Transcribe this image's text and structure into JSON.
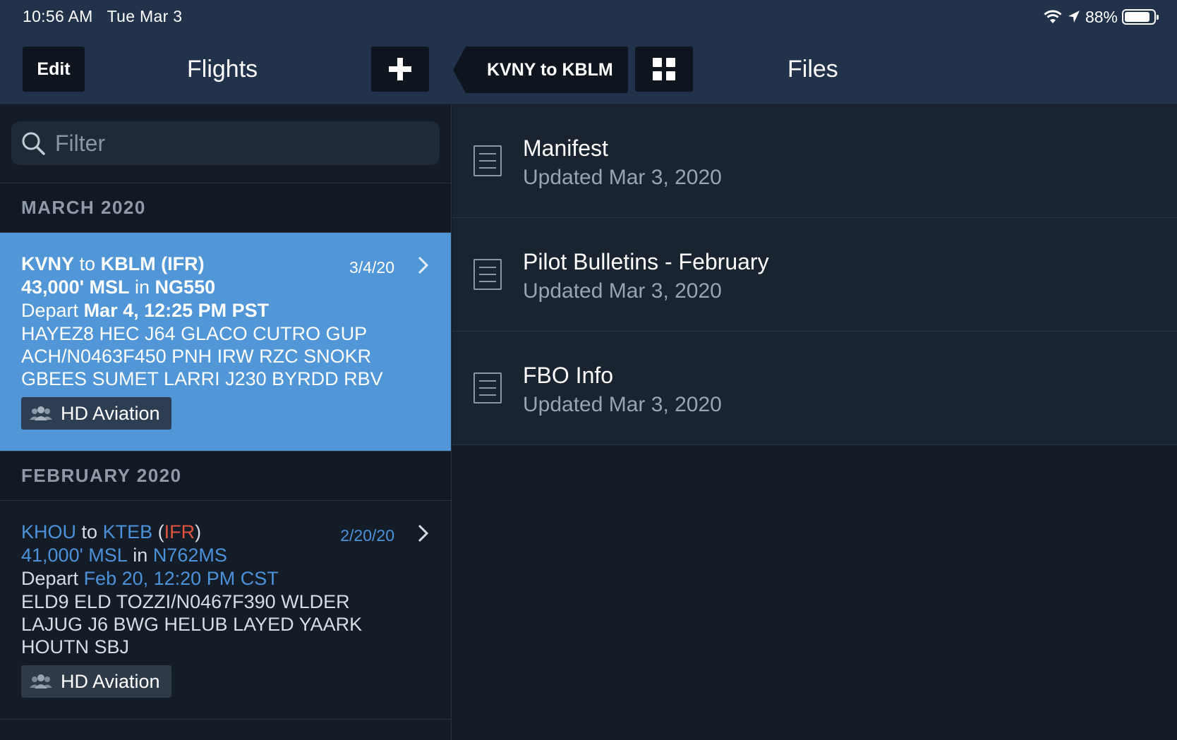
{
  "status": {
    "time": "10:56 AM",
    "date": "Tue Mar 3",
    "battery": "88%",
    "battery_level": 0.88
  },
  "nav": {
    "edit_label": "Edit",
    "flights_title": "Flights",
    "back_label": "KVNY to KBLM",
    "files_title": "Files"
  },
  "filter": {
    "placeholder": "Filter"
  },
  "sections": {
    "march": "MARCH 2020",
    "february": "FEBRUARY 2020"
  },
  "flights": [
    {
      "from": "KVNY",
      "to_word": "to",
      "to": "KBLM",
      "rules": "IFR",
      "date": "3/4/20",
      "altitude": "43,000' MSL",
      "in_word": "in",
      "aircraft": "NG550",
      "depart_word": "Depart",
      "depart_time": "Mar 4, 12:25 PM PST",
      "route_lines": [
        "HAYEZ8 HEC J64 GLACO CUTRO GUP",
        "ACH/N0463F450 PNH IRW RZC SNOKR",
        "GBEES SUMET LARRI J230 BYRDD RBV"
      ],
      "team": "HD Aviation"
    },
    {
      "from": "KHOU",
      "to_word": "to",
      "to": "KTEB",
      "rules": "IFR",
      "date": "2/20/20",
      "altitude": "41,000' MSL",
      "in_word": "in",
      "aircraft": "N762MS",
      "depart_word": "Depart",
      "depart_time": "Feb 20, 12:20 PM CST",
      "route_lines": [
        "ELD9 ELD TOZZI/N0467F390 WLDER",
        "LAJUG J6 BWG HELUB LAYED YAARK",
        "HOUTN SBJ"
      ],
      "team": "HD Aviation"
    }
  ],
  "files": [
    {
      "name": "Manifest",
      "updated": "Updated Mar 3, 2020"
    },
    {
      "name": "Pilot Bulletins - February",
      "updated": "Updated Mar 3, 2020"
    },
    {
      "name": "FBO Info",
      "updated": "Updated Mar 3, 2020"
    }
  ],
  "colors": {
    "nav_bg": "#22324a",
    "selected_row": "#5196d6",
    "accent_blue": "#4b92db",
    "ifr_red": "#e0533f"
  }
}
